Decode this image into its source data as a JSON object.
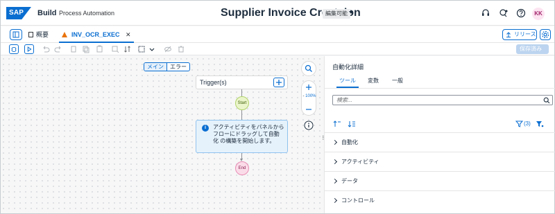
{
  "shell": {
    "logo_text": "SAP",
    "brand": "Build",
    "product": "Process Automation",
    "project_title": "Supplier Invoice Createion",
    "edit_badge": "編集可能",
    "avatar": "KK"
  },
  "tabs": {
    "overview": "概要",
    "active": "INV_OCR_EXEC",
    "release": "リリース"
  },
  "toolbar": {
    "saved": "保存済み"
  },
  "canvas": {
    "segments": [
      "メイン",
      "エラー"
    ],
    "trigger_label": "Trigger(s)",
    "start_label": "Start",
    "info_text": "アクティビティをパネルから フローにドラッグして自動化 の構築を開始します。",
    "end_label": "End",
    "zoom": "100%"
  },
  "panel": {
    "title": "自動化詳細",
    "tabs": [
      "ツール",
      "変数",
      "一般"
    ],
    "search_placeholder": "検索...",
    "filter_count": "(3)",
    "items": [
      "自動化",
      "アクティビティ",
      "データ",
      "コントロール"
    ]
  },
  "colors": {
    "accent": "#0a6ed1",
    "start_fill": "#ebf5cb",
    "end_fill": "#fadce8",
    "info_fill": "#e6f2fb"
  }
}
